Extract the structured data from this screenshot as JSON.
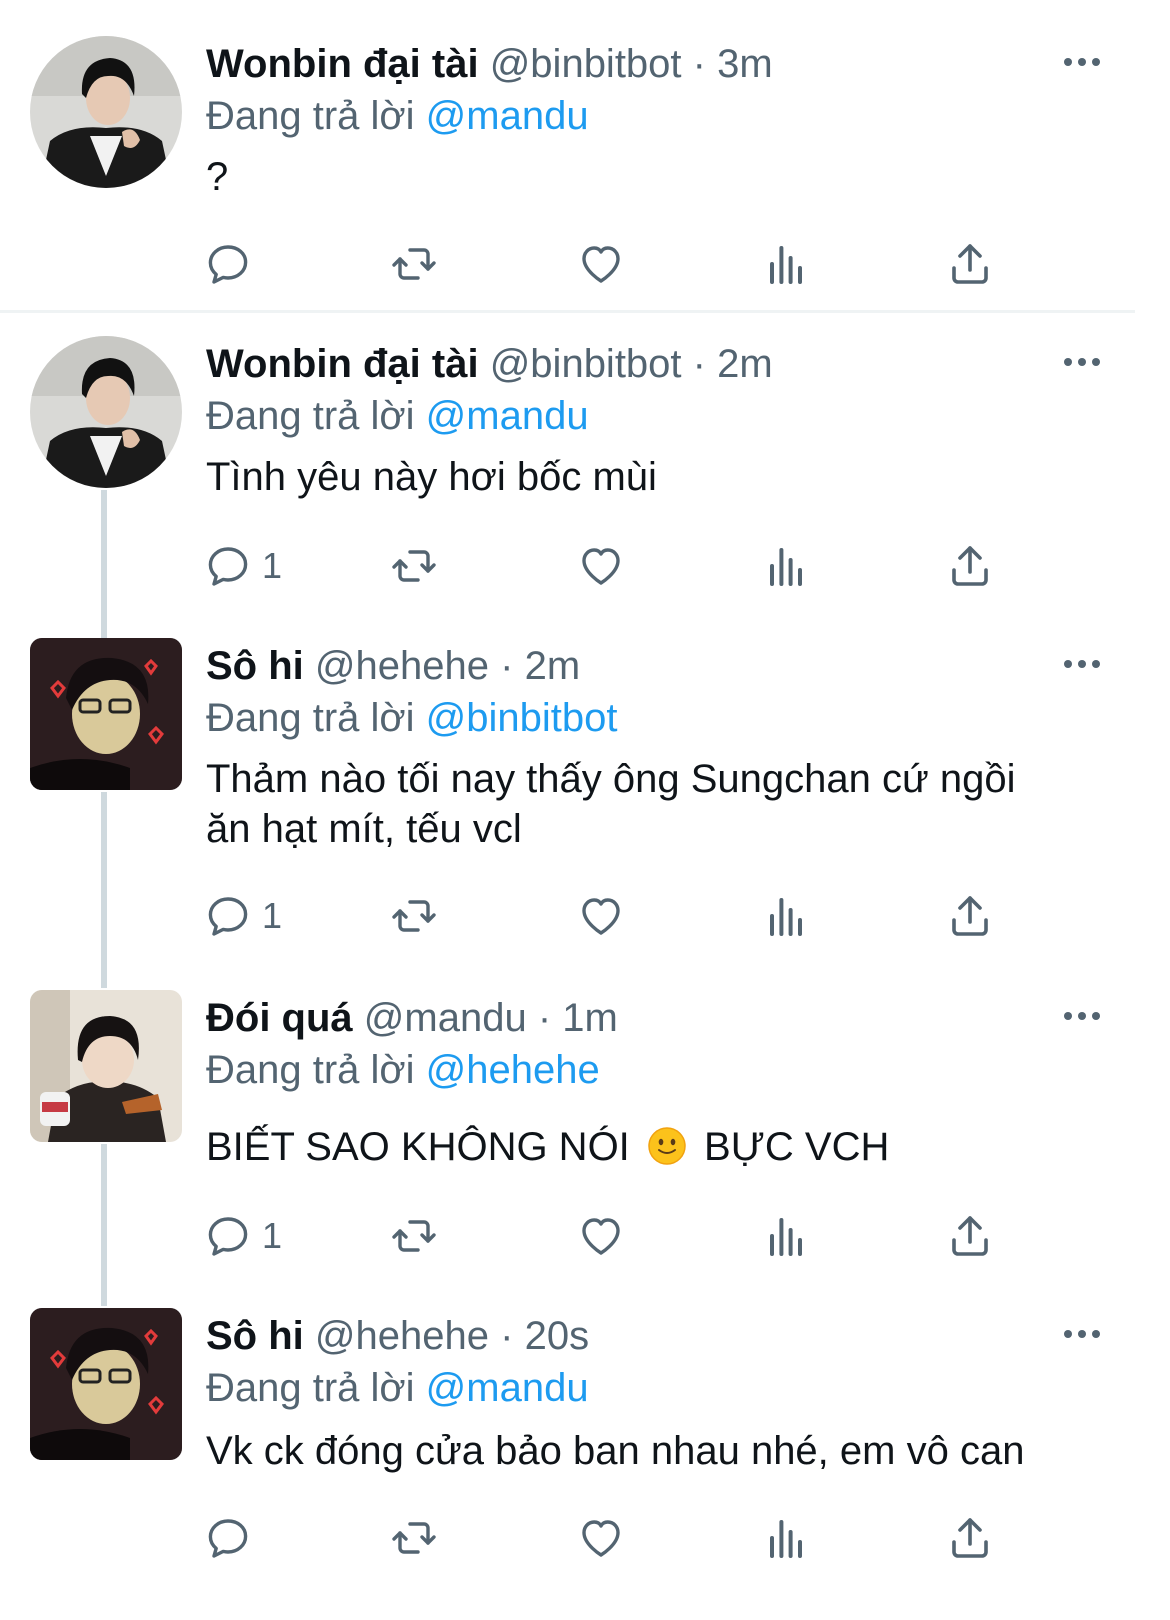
{
  "tweets": [
    {
      "name": "Wonbin đại tài",
      "handle": "@binbitbot",
      "time": "3m",
      "reply_prefix": "Đang trả lời",
      "reply_to": "@mandu",
      "text": "?",
      "reply_count": "",
      "avatar": "wonbin-avatar"
    },
    {
      "name": "Wonbin đại tài",
      "handle": "@binbitbot",
      "time": "2m",
      "reply_prefix": "Đang trả lời",
      "reply_to": "@mandu",
      "text": "Tình yêu này hơi bốc mùi",
      "reply_count": "1",
      "avatar": "wonbin-avatar"
    },
    {
      "name": "Sô hi",
      "handle": "@hehehe",
      "time": "2m",
      "reply_prefix": "Đang trả lời",
      "reply_to": "@binbitbot",
      "text_line1": "Thảm nào tối nay thấy ông Sungchan cứ ngồi",
      "text_line2": "ăn hạt mít, tếu vcl",
      "reply_count": "1",
      "avatar": "sohi-avatar"
    },
    {
      "name": "Đói quá",
      "handle": "@mandu",
      "time": "1m",
      "reply_prefix": "Đang trả lời",
      "reply_to": "@hehehe",
      "text_before": "BIẾT SAO KHÔNG NÓI",
      "text_after": "BỰC VCH",
      "emoji": "slightly-smiling-face-emoji",
      "reply_count": "1",
      "avatar": "mandu-avatar"
    },
    {
      "name": "Sô hi",
      "handle": "@hehehe",
      "time": "20s",
      "reply_prefix": "Đang trả lời",
      "reply_to": "@mandu",
      "text": "Vk ck đóng cửa bảo ban nhau nhé, em vô can",
      "reply_count": "",
      "avatar": "sohi-avatar"
    }
  ],
  "separator": "·",
  "colors": {
    "link": "#1d9bf0",
    "secondary_text": "#536471",
    "primary_text": "#0f1419",
    "thread_line": "#cfd9de"
  },
  "action_icons": [
    "reply-icon",
    "retweet-icon",
    "like-icon",
    "views-icon",
    "share-icon"
  ]
}
